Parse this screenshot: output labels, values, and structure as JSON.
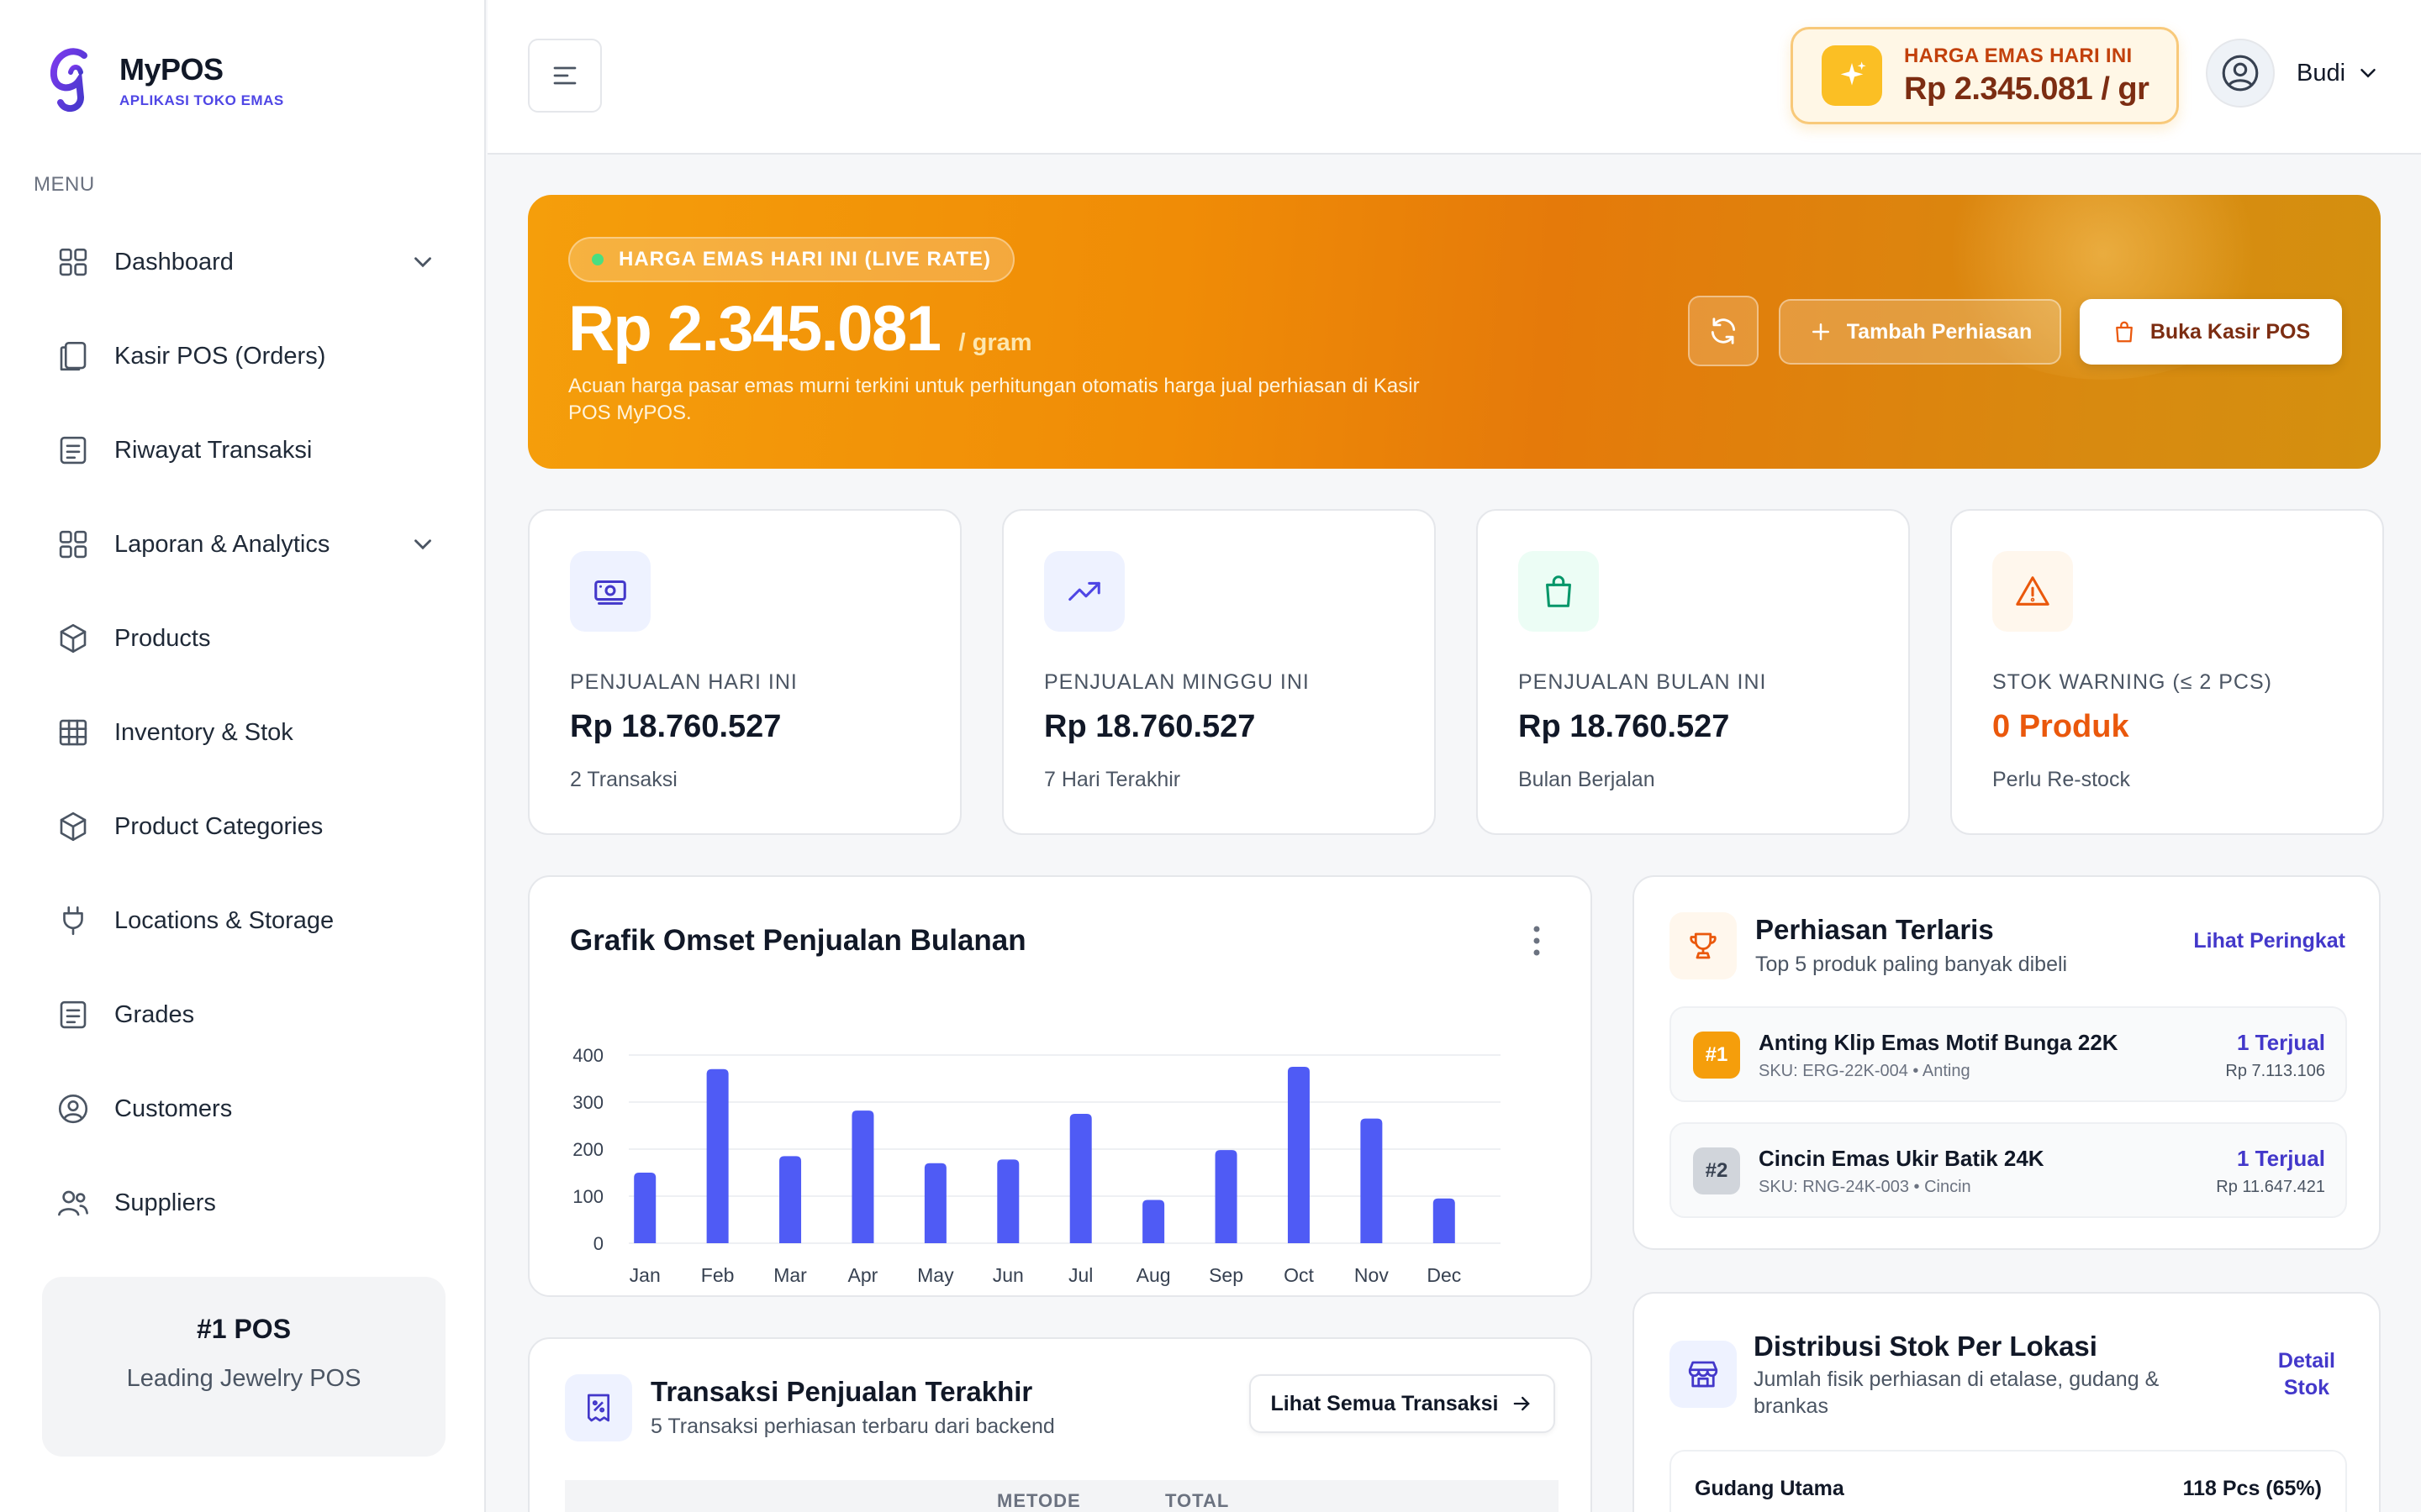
{
  "brand": {
    "name": "MyPOS",
    "tagline": "APLIKASI TOKO EMAS"
  },
  "sidebar": {
    "menu_title": "MENU",
    "items": [
      {
        "label": "Dashboard",
        "icon": "grid-icon",
        "has_chevron": true
      },
      {
        "label": "Kasir POS (Orders)",
        "icon": "copy-icon",
        "has_chevron": false
      },
      {
        "label": "Riwayat Transaksi",
        "icon": "list-icon",
        "has_chevron": false
      },
      {
        "label": "Laporan & Analytics",
        "icon": "grid-icon",
        "has_chevron": true
      },
      {
        "label": "Products",
        "icon": "box-icon",
        "has_chevron": false
      },
      {
        "label": "Inventory & Stok",
        "icon": "table-icon",
        "has_chevron": false
      },
      {
        "label": "Product Categories",
        "icon": "box-icon",
        "has_chevron": false
      },
      {
        "label": "Locations & Storage",
        "icon": "plug-icon",
        "has_chevron": false
      },
      {
        "label": "Grades",
        "icon": "list-icon",
        "has_chevron": false
      },
      {
        "label": "Customers",
        "icon": "user-circle-icon",
        "has_chevron": false
      },
      {
        "label": "Suppliers",
        "icon": "users-icon",
        "has_chevron": false
      }
    ],
    "promo": {
      "title": "#1 POS",
      "subtitle": "Leading Jewelry POS"
    }
  },
  "header": {
    "gold_label": "HARGA EMAS HARI INI",
    "gold_value": "Rp 2.345.081 / gr",
    "user_name": "Budi"
  },
  "hero": {
    "badge": "HARGA EMAS HARI INI (LIVE RATE)",
    "price": "Rp 2.345.081",
    "unit": "/ gram",
    "description": "Acuan harga pasar emas murni terkini untuk perhitungan otomatis harga jual perhiasan di Kasir POS MyPOS.",
    "add_button": "Tambah Perhiasan",
    "pos_button": "Buka Kasir POS"
  },
  "stats": [
    {
      "label": "PENJUALAN HARI INI",
      "value": "Rp 18.760.527",
      "sub": "2 Transaksi",
      "icon": "money-icon",
      "accent": "#4338ca",
      "tile": "#eef2ff",
      "value_color": "#111827"
    },
    {
      "label": "PENJUALAN MINGGU INI",
      "value": "Rp 18.760.527",
      "sub": "7 Hari Terakhir",
      "icon": "trend-up-icon",
      "accent": "#4f46e5",
      "tile": "#eef2ff",
      "value_color": "#111827"
    },
    {
      "label": "PENJUALAN BULAN INI",
      "value": "Rp 18.760.527",
      "sub": "Bulan Berjalan",
      "icon": "bag-icon",
      "accent": "#059669",
      "tile": "#ecfdf5",
      "value_color": "#111827"
    },
    {
      "label": "STOK WARNING (≤ 2 PCS)",
      "value": "0 Produk",
      "sub": "Perlu Re-stock",
      "icon": "warning-icon",
      "accent": "#ea580c",
      "tile": "#fff7ed",
      "value_color": "#ea580c"
    }
  ],
  "chart": {
    "title": "Grafik Omset Penjualan Bulanan"
  },
  "chart_data": {
    "type": "bar",
    "title": "Grafik Omset Penjualan Bulanan",
    "categories": [
      "Jan",
      "Feb",
      "Mar",
      "Apr",
      "May",
      "Jun",
      "Jul",
      "Aug",
      "Sep",
      "Oct",
      "Nov",
      "Dec"
    ],
    "values": [
      150,
      370,
      185,
      282,
      170,
      178,
      275,
      92,
      198,
      375,
      265,
      95
    ],
    "yticks": [
      0,
      100,
      200,
      300,
      400
    ],
    "ylim": [
      0,
      400
    ],
    "color": "#4f5bf5",
    "grid": true
  },
  "top_sellers": {
    "title": "Perhiasan Terlaris",
    "subtitle": "Top 5 produk paling banyak dibeli",
    "link": "Lihat Peringkat",
    "items": [
      {
        "rank": "#1",
        "name": "Anting Klip Emas Motif Bunga 22K",
        "sku": "SKU: ERG-22K-004 • Anting",
        "sold": "1 Terjual",
        "price": "Rp 7.113.106",
        "badge_bg": "#f59e0b",
        "badge_fg": "#ffffff"
      },
      {
        "rank": "#2",
        "name": "Cincin Emas Ukir Batik 24K",
        "sku": "SKU: RNG-24K-003 • Cincin",
        "sold": "1 Terjual",
        "price": "Rp 11.647.421",
        "badge_bg": "#d1d5db",
        "badge_fg": "#374151"
      }
    ]
  },
  "transactions": {
    "title": "Transaksi Penjualan Terakhir",
    "subtitle": "5 Transaksi perhiasan terbaru dari backend",
    "button": "Lihat Semua Transaksi",
    "columns": [
      "METODE",
      "TOTAL"
    ]
  },
  "stock": {
    "title": "Distribusi Stok Per Lokasi",
    "subtitle_line1": "Jumlah fisik perhiasan di etalase, gudang &",
    "subtitle_line2": "brankas",
    "link_line1": "Detail",
    "link_line2": "Stok",
    "rows": [
      {
        "name": "Gudang Utama",
        "qty": "118 Pcs (65%)"
      }
    ]
  }
}
